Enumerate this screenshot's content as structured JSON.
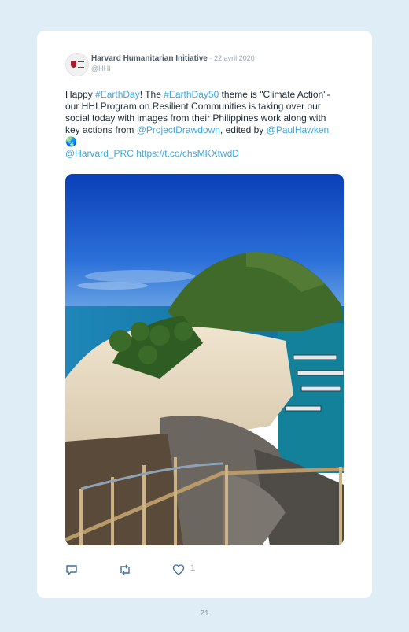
{
  "tweet": {
    "author_name": "Harvard Humanitarian Initiative",
    "date": "· 22 avril 2020",
    "handle": "@HHI",
    "text": {
      "t1": "Happy ",
      "l1": "#EarthDay",
      "t2": "! The ",
      "l2": "#EarthDay50",
      "t3": " theme is \"Climate Action\"- our HHI Program on Resilient Communities is taking over our social today with images from their Philippines work along with key actions from ",
      "l3": "@ProjectDrawdown",
      "t4": ", edited by ",
      "l4": "@PaulHawken",
      "emoji": " 🌏",
      "l5": "@Harvard_PRC",
      "l6": "https://t.co/chsMKXtwdD"
    },
    "likes": "1"
  },
  "icons": [
    "reply-icon",
    "retweet-icon",
    "heart-icon"
  ],
  "colors": {
    "background": "#dfeef6",
    "link": "#3fa6e0",
    "brand": "#a51c30"
  },
  "page_number": "21"
}
